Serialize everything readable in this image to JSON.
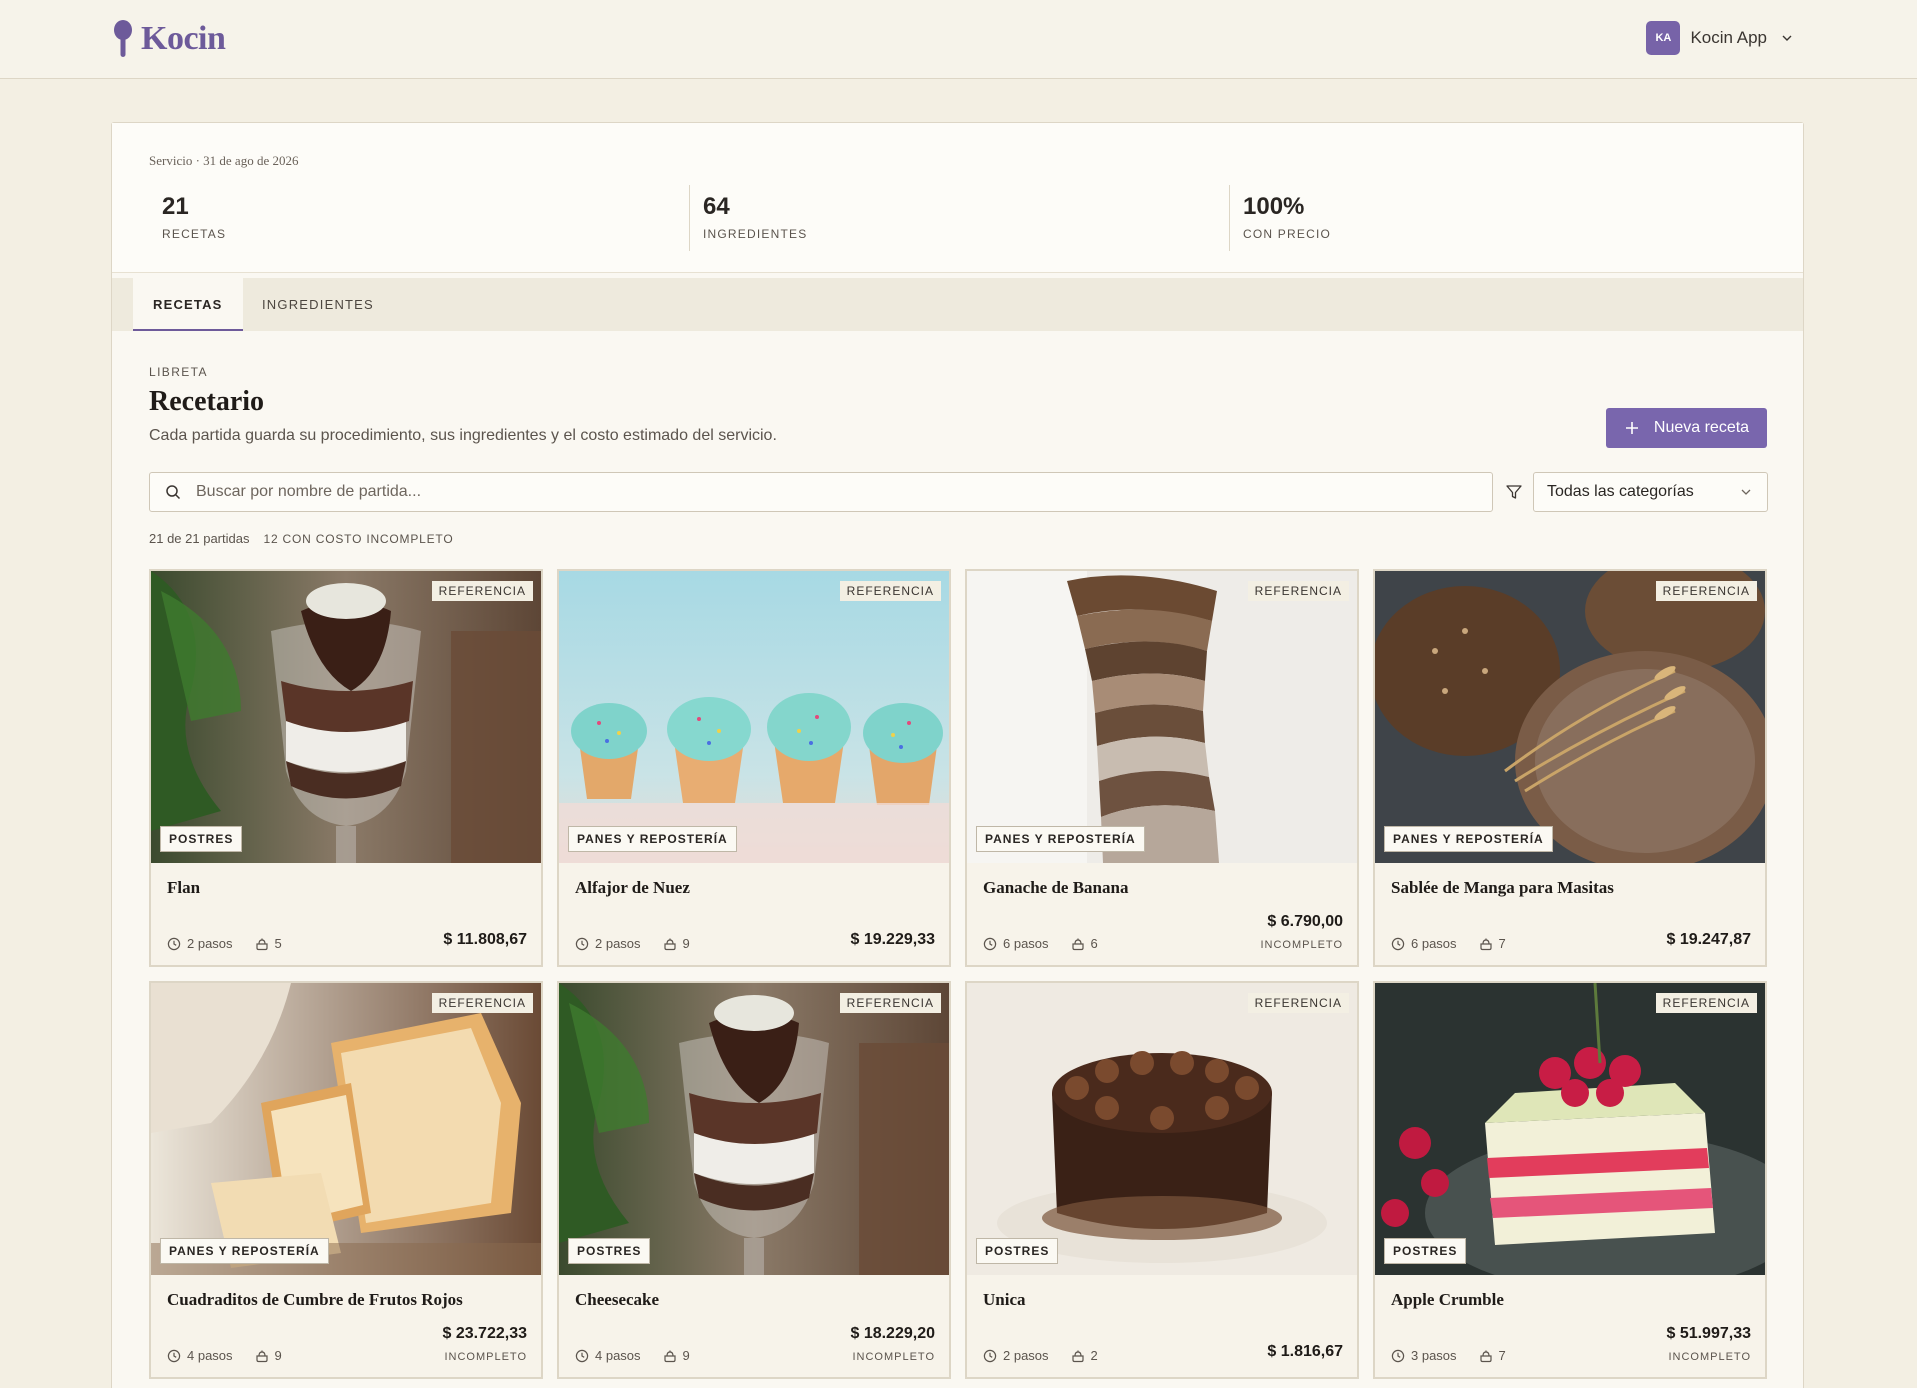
{
  "app": {
    "brand": "Kocin",
    "user": {
      "initials": "KA",
      "name": "Kocin App"
    }
  },
  "summary": {
    "service_date": "Servicio · 31 de ago de 2026",
    "stats": [
      {
        "value": "21",
        "label": "RECETAS"
      },
      {
        "value": "64",
        "label": "INGREDIENTES"
      },
      {
        "value": "100%",
        "label": "CON PRECIO"
      }
    ]
  },
  "tabs": [
    {
      "label": "RECETAS",
      "active": true
    },
    {
      "label": "INGREDIENTES",
      "active": false
    }
  ],
  "header": {
    "eyebrow": "LIBRETA",
    "title": "Recetario",
    "description": "Cada partida guarda su procedimiento, sus ingredientes y el costo estimado del servicio.",
    "new_button": "Nueva receta"
  },
  "filters": {
    "search_placeholder": "Buscar por nombre de partida...",
    "category": "Todas las categorías"
  },
  "counts": {
    "text": "21 de 21 partidas",
    "incomplete": "12 CON COSTO INCOMPLETO"
  },
  "ref_label": "REFERENCIA",
  "cards": [
    {
      "title": "Flan",
      "category": "POSTRES",
      "steps": "2 pasos",
      "ingredients": "5",
      "price": "$ 11.808,67",
      "status": "",
      "image": "dessert-glass"
    },
    {
      "title": "Alfajor de Nuez",
      "category": "PANES Y REPOSTERÍA",
      "steps": "2 pasos",
      "ingredients": "9",
      "price": "$ 19.229,33",
      "status": "",
      "image": "cupcakes"
    },
    {
      "title": "Ganache de Banana",
      "category": "PANES Y REPOSTERÍA",
      "steps": "6 pasos",
      "ingredients": "6",
      "price": "$ 6.790,00",
      "status": "INCOMPLETO",
      "image": "sliced-bread"
    },
    {
      "title": "Sablée de Manga para Masitas",
      "category": "PANES Y REPOSTERÍA",
      "steps": "6 pasos",
      "ingredients": "7",
      "price": "$ 19.247,87",
      "status": "",
      "image": "round-loaves"
    },
    {
      "title": "Cuadraditos de Cumbre de Frutos Rojos",
      "category": "PANES Y REPOSTERÍA",
      "steps": "4 pasos",
      "ingredients": "9",
      "price": "$ 23.722,33",
      "status": "INCOMPLETO",
      "image": "white-bread"
    },
    {
      "title": "Cheesecake",
      "category": "POSTRES",
      "steps": "4 pasos",
      "ingredients": "9",
      "price": "$ 18.229,20",
      "status": "INCOMPLETO",
      "image": "dessert-glass"
    },
    {
      "title": "Unica",
      "category": "POSTRES",
      "steps": "2 pasos",
      "ingredients": "2",
      "price": "$ 1.816,67",
      "status": "",
      "image": "chocolate-cake"
    },
    {
      "title": "Apple Crumble",
      "category": "POSTRES",
      "steps": "3 pasos",
      "ingredients": "7",
      "price": "$ 51.997,33",
      "status": "INCOMPLETO",
      "image": "berry-cake"
    }
  ],
  "colors": {
    "accent": "#7966ad",
    "background": "#f3efe3",
    "brand": "#6d5a9a"
  }
}
